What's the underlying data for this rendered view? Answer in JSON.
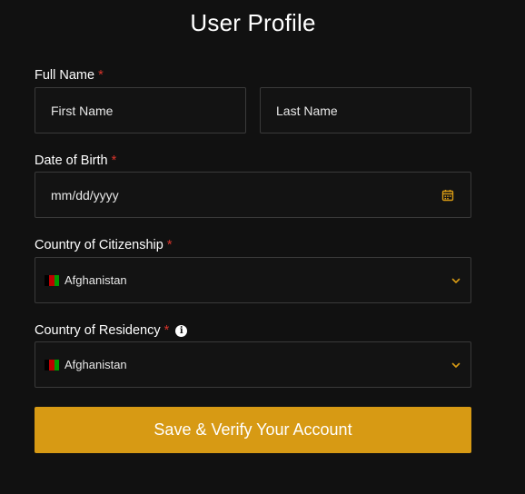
{
  "page": {
    "title": "User Profile"
  },
  "form": {
    "full_name": {
      "label": "Full Name",
      "required_mark": "*",
      "first_placeholder": "First Name",
      "last_placeholder": "Last Name"
    },
    "dob": {
      "label": "Date of Birth",
      "required_mark": "*",
      "placeholder": "mm/dd/yyyy",
      "icon": "calendar-icon"
    },
    "citizenship": {
      "label": "Country of Citizenship",
      "required_mark": "*",
      "selected": "Afghanistan",
      "icon": "chevron-down-icon"
    },
    "residency": {
      "label": "Country of Residency",
      "required_mark": "*",
      "info_icon_glyph": "i",
      "selected": "Afghanistan",
      "icon": "chevron-down-icon"
    },
    "submit_label": "Save & Verify Your Account"
  },
  "colors": {
    "background": "#111111",
    "accent": "#d79a14",
    "required": "#d9342b",
    "border": "#3a3a3a"
  }
}
